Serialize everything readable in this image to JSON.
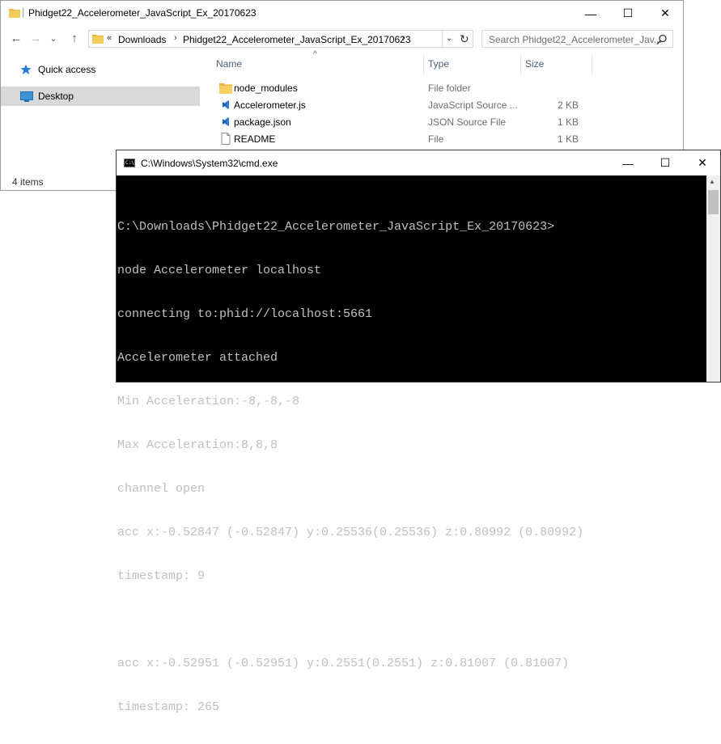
{
  "explorer": {
    "title": "Phidget22_Accelerometer_JavaScript_Ex_20170623",
    "window_controls": {
      "minimize": "—",
      "maximize": "☐",
      "close": "✕"
    },
    "nav": {
      "back": "←",
      "forward": "→",
      "recent": "⌄",
      "up": "↑"
    },
    "address": {
      "overflow": "«",
      "crumbs": [
        "Downloads",
        "Phidget22_Accelerometer_JavaScript_Ex_20170623"
      ],
      "separator": "›",
      "dropdown": "⌄",
      "refresh": "↻"
    },
    "search": {
      "placeholder": "Search Phidget22_Accelerometer_Jav...",
      "icon": "search-icon"
    },
    "sidebar": {
      "items": [
        {
          "label": "Quick access",
          "icon": "star-icon",
          "selected": false
        },
        {
          "label": "Desktop",
          "icon": "desktop-icon",
          "selected": true
        }
      ]
    },
    "columns": {
      "name": "Name",
      "type": "Type",
      "size": "Size"
    },
    "files": [
      {
        "name": "node_modules",
        "type": "File folder",
        "size": "",
        "icon": "folder-icon"
      },
      {
        "name": "Accelerometer.js",
        "type": "JavaScript Source ...",
        "size": "2 KB",
        "icon": "vscode-file-icon"
      },
      {
        "name": "package.json",
        "type": "JSON Source File",
        "size": "1 KB",
        "icon": "vscode-file-icon"
      },
      {
        "name": "README",
        "type": "File",
        "size": "1 KB",
        "icon": "blank-file-icon"
      }
    ],
    "status": "4 items"
  },
  "cmd": {
    "title": "C:\\Windows\\System32\\cmd.exe",
    "icon_text": "C:\\",
    "window_controls": {
      "minimize": "—",
      "maximize": "☐",
      "close": "✕"
    },
    "lines": [
      "C:\\Downloads\\Phidget22_Accelerometer_JavaScript_Ex_20170623>",
      "node Accelerometer localhost",
      "connecting to:phid://localhost:5661",
      "Accelerometer attached",
      "Min Acceleration:-8,-8,-8",
      "Max Acceleration:8,8,8",
      "channel open",
      "acc x:-0.52847 (-0.52847) y:0.25536(0.25536) z:0.80992 (0.80992)",
      "timestamp: 9",
      "",
      "acc x:-0.52951 (-0.52951) y:0.2551(0.2551) z:0.81007 (0.81007)",
      "timestamp: 265"
    ]
  },
  "colors": {
    "folder": "#e8b83a",
    "vscode_blue": "#2e7bd6",
    "selection": "#d9d9d9",
    "console_bg": "#000000",
    "console_text": "#c0c0c0"
  }
}
